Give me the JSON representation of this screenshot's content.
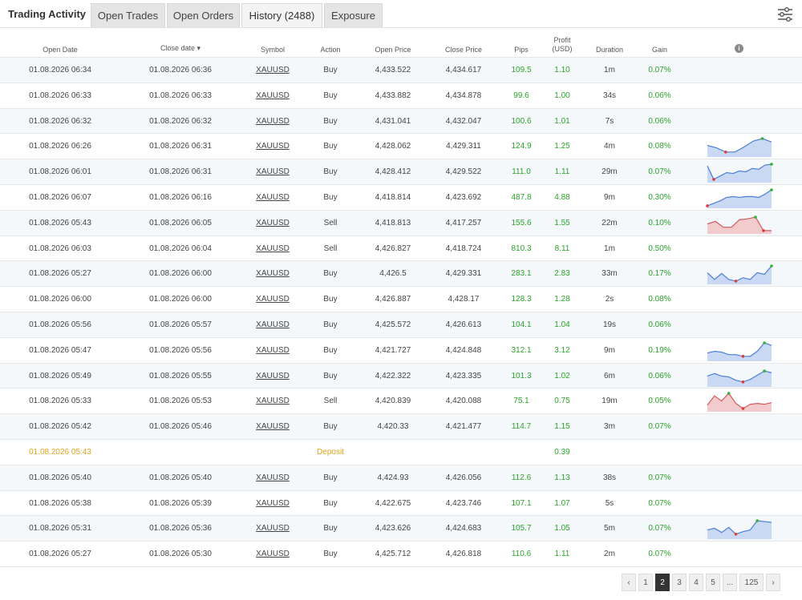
{
  "header": {
    "title": "Trading Activity",
    "tabs": [
      {
        "label": "Open Trades"
      },
      {
        "label": "Open Orders"
      },
      {
        "label": "History (2488)"
      },
      {
        "label": "Exposure"
      }
    ],
    "active_tab": "History (2488)"
  },
  "table": {
    "columns": {
      "open_date": "Open Date",
      "close_date": "Close date ▾",
      "symbol": "Symbol",
      "action": "Action",
      "open_price": "Open Price",
      "close_price": "Close Price",
      "pips": "Pips",
      "profit": "Profit (USD)",
      "duration": "Duration",
      "gain": "Gain"
    },
    "rows": [
      {
        "open_date": "01.08.2026 06:34",
        "close_date": "01.08.2026 06:36",
        "symbol": "XAUUSD",
        "action": "Buy",
        "open_price": "4,433.522",
        "close_price": "4,434.617",
        "pips": "109.5",
        "profit": "1.10",
        "duration": "1m",
        "gain": "0.07%"
      },
      {
        "open_date": "01.08.2026 06:33",
        "close_date": "01.08.2026 06:33",
        "symbol": "XAUUSD",
        "action": "Buy",
        "open_price": "4,433.882",
        "close_price": "4,434.878",
        "pips": "99.6",
        "profit": "1.00",
        "duration": "34s",
        "gain": "0.06%"
      },
      {
        "open_date": "01.08.2026 06:32",
        "close_date": "01.08.2026 06:32",
        "symbol": "XAUUSD",
        "action": "Buy",
        "open_price": "4,431.041",
        "close_price": "4,432.047",
        "pips": "100.6",
        "profit": "1.01",
        "duration": "7s",
        "gain": "0.06%"
      },
      {
        "open_date": "01.08.2026 06:26",
        "close_date": "01.08.2026 06:31",
        "symbol": "XAUUSD",
        "action": "Buy",
        "open_price": "4,428.062",
        "close_price": "4,429.311",
        "pips": "124.9",
        "profit": "1.25",
        "duration": "4m",
        "gain": "0.08%"
      },
      {
        "open_date": "01.08.2026 06:01",
        "close_date": "01.08.2026 06:31",
        "symbol": "XAUUSD",
        "action": "Buy",
        "open_price": "4,428.412",
        "close_price": "4,429.522",
        "pips": "111.0",
        "profit": "1.11",
        "duration": "29m",
        "gain": "0.07%"
      },
      {
        "open_date": "01.08.2026 06:07",
        "close_date": "01.08.2026 06:16",
        "symbol": "XAUUSD",
        "action": "Buy",
        "open_price": "4,418.814",
        "close_price": "4,423.692",
        "pips": "487.8",
        "profit": "4.88",
        "duration": "9m",
        "gain": "0.30%"
      },
      {
        "open_date": "01.08.2026 05:43",
        "close_date": "01.08.2026 06:05",
        "symbol": "XAUUSD",
        "action": "Sell",
        "open_price": "4,418.813",
        "close_price": "4,417.257",
        "pips": "155.6",
        "profit": "1.55",
        "duration": "22m",
        "gain": "0.10%"
      },
      {
        "open_date": "01.08.2026 06:03",
        "close_date": "01.08.2026 06:04",
        "symbol": "XAUUSD",
        "action": "Sell",
        "open_price": "4,426.827",
        "close_price": "4,418.724",
        "pips": "810.3",
        "profit": "8.11",
        "duration": "1m",
        "gain": "0.50%"
      },
      {
        "open_date": "01.08.2026 05:27",
        "close_date": "01.08.2026 06:00",
        "symbol": "XAUUSD",
        "action": "Buy",
        "open_price": "4,426.5",
        "close_price": "4,429.331",
        "pips": "283.1",
        "profit": "2.83",
        "duration": "33m",
        "gain": "0.17%"
      },
      {
        "open_date": "01.08.2026 06:00",
        "close_date": "01.08.2026 06:00",
        "symbol": "XAUUSD",
        "action": "Buy",
        "open_price": "4,426.887",
        "close_price": "4,428.17",
        "pips": "128.3",
        "profit": "1.28",
        "duration": "2s",
        "gain": "0.08%"
      },
      {
        "open_date": "01.08.2026 05:56",
        "close_date": "01.08.2026 05:57",
        "symbol": "XAUUSD",
        "action": "Buy",
        "open_price": "4,425.572",
        "close_price": "4,426.613",
        "pips": "104.1",
        "profit": "1.04",
        "duration": "19s",
        "gain": "0.06%"
      },
      {
        "open_date": "01.08.2026 05:47",
        "close_date": "01.08.2026 05:56",
        "symbol": "XAUUSD",
        "action": "Buy",
        "open_price": "4,421.727",
        "close_price": "4,424.848",
        "pips": "312.1",
        "profit": "3.12",
        "duration": "9m",
        "gain": "0.19%"
      },
      {
        "open_date": "01.08.2026 05:49",
        "close_date": "01.08.2026 05:55",
        "symbol": "XAUUSD",
        "action": "Buy",
        "open_price": "4,422.322",
        "close_price": "4,423.335",
        "pips": "101.3",
        "profit": "1.02",
        "duration": "6m",
        "gain": "0.06%"
      },
      {
        "open_date": "01.08.2026 05:33",
        "close_date": "01.08.2026 05:53",
        "symbol": "XAUUSD",
        "action": "Sell",
        "open_price": "4,420.839",
        "close_price": "4,420.088",
        "pips": "75.1",
        "profit": "0.75",
        "duration": "19m",
        "gain": "0.05%"
      },
      {
        "open_date": "01.08.2026 05:42",
        "close_date": "01.08.2026 05:46",
        "symbol": "XAUUSD",
        "action": "Buy",
        "open_price": "4,420.33",
        "close_price": "4,421.477",
        "pips": "114.7",
        "profit": "1.15",
        "duration": "3m",
        "gain": "0.07%"
      },
      {
        "open_date": "01.08.2026 05:43",
        "close_date": "",
        "symbol": "",
        "action": "Deposit",
        "open_price": "",
        "close_price": "",
        "pips": "",
        "profit": "0.39",
        "duration": "",
        "gain": "",
        "is_deposit": true
      },
      {
        "open_date": "01.08.2026 05:40",
        "close_date": "01.08.2026 05:40",
        "symbol": "XAUUSD",
        "action": "Buy",
        "open_price": "4,424.93",
        "close_price": "4,426.056",
        "pips": "112.6",
        "profit": "1.13",
        "duration": "38s",
        "gain": "0.07%"
      },
      {
        "open_date": "01.08.2026 05:38",
        "close_date": "01.08.2026 05:39",
        "symbol": "XAUUSD",
        "action": "Buy",
        "open_price": "4,422.675",
        "close_price": "4,423.746",
        "pips": "107.1",
        "profit": "1.07",
        "duration": "5s",
        "gain": "0.07%"
      },
      {
        "open_date": "01.08.2026 05:31",
        "close_date": "01.08.2026 05:36",
        "symbol": "XAUUSD",
        "action": "Buy",
        "open_price": "4,423.626",
        "close_price": "4,424.683",
        "pips": "105.7",
        "profit": "1.05",
        "duration": "5m",
        "gain": "0.07%"
      },
      {
        "open_date": "01.08.2026 05:27",
        "close_date": "01.08.2026 05:30",
        "symbol": "XAUUSD",
        "action": "Buy",
        "open_price": "4,425.712",
        "close_price": "4,426.818",
        "pips": "110.6",
        "profit": "1.11",
        "duration": "2m",
        "gain": "0.07%"
      }
    ],
    "sparklines": [
      {
        "row": 3,
        "kind": "buy",
        "values": [
          0.6,
          0.45,
          0.2,
          0.2,
          0.5,
          0.85,
          1.0,
          0.8
        ]
      },
      {
        "row": 4,
        "kind": "buy",
        "values": [
          0.9,
          0.1,
          0.3,
          0.5,
          0.45,
          0.6,
          0.55,
          0.75,
          0.7,
          0.95,
          1.0
        ]
      },
      {
        "row": 5,
        "kind": "buy",
        "values": [
          0.05,
          0.2,
          0.35,
          0.55,
          0.6,
          0.55,
          0.6,
          0.6,
          0.55,
          0.75,
          1.0
        ]
      },
      {
        "row": 6,
        "kind": "sell",
        "values": [
          0.5,
          0.65,
          0.3,
          0.3,
          0.75,
          0.8,
          0.9,
          0.1,
          0.1
        ]
      },
      {
        "row": 8,
        "kind": "buy",
        "values": [
          0.6,
          0.2,
          0.55,
          0.2,
          0.1,
          0.3,
          0.2,
          0.6,
          0.5,
          1.0
        ]
      },
      {
        "row": 11,
        "kind": "buy",
        "values": [
          0.4,
          0.5,
          0.45,
          0.3,
          0.3,
          0.2,
          0.2,
          0.5,
          1.0,
          0.85
        ]
      },
      {
        "row": 12,
        "kind": "buy",
        "values": [
          0.55,
          0.7,
          0.55,
          0.5,
          0.3,
          0.2,
          0.35,
          0.6,
          0.85,
          0.75
        ]
      },
      {
        "row": 13,
        "kind": "sell",
        "values": [
          0.3,
          0.85,
          0.55,
          1.0,
          0.4,
          0.1,
          0.35,
          0.4,
          0.35,
          0.45
        ]
      },
      {
        "row": 18,
        "kind": "buy",
        "values": [
          0.45,
          0.55,
          0.3,
          0.6,
          0.2,
          0.35,
          0.45,
          1.0,
          0.95,
          0.9
        ]
      }
    ]
  },
  "pagination": {
    "prev": "‹",
    "pages": [
      "1",
      "2",
      "3",
      "4",
      "5",
      "...",
      "125"
    ],
    "current": "2",
    "next": "›"
  },
  "colors": {
    "green": "#2aa32a",
    "deposit": "#e0a21a",
    "buy_line": "#4a7fd8",
    "buy_fill": "#c9d9f3",
    "sell_line": "#d05a5a",
    "sell_fill": "#f2cccc",
    "marker_red": "#e03a3a",
    "marker_green": "#33b033"
  }
}
